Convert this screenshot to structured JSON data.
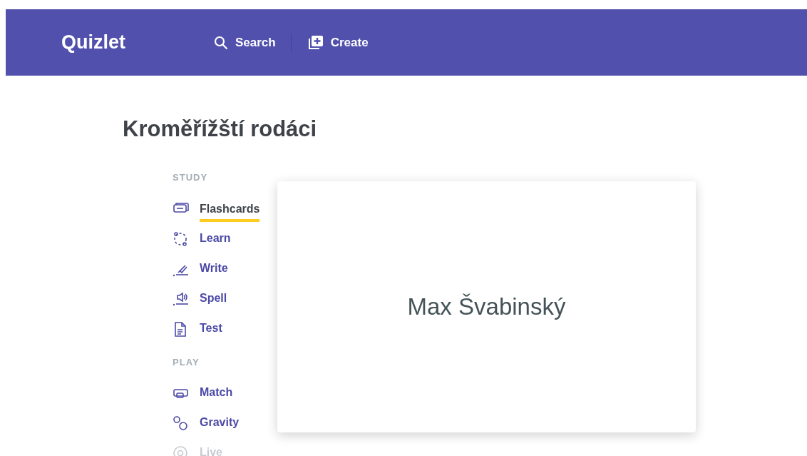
{
  "header": {
    "logo": "Quizlet",
    "nav": [
      {
        "kind": "search",
        "label": "Search"
      },
      {
        "kind": "create",
        "label": "Create"
      }
    ]
  },
  "title": "Kroměřížští rodáci",
  "sections": [
    {
      "heading": "STUDY",
      "items": [
        {
          "kind": "flashcards",
          "label": "Flashcards",
          "selected": true,
          "disabled": false
        },
        {
          "kind": "learn",
          "label": "Learn",
          "selected": false,
          "disabled": false
        },
        {
          "kind": "write",
          "label": "Write",
          "selected": false,
          "disabled": false
        },
        {
          "kind": "spell",
          "label": "Spell",
          "selected": false,
          "disabled": false
        },
        {
          "kind": "test",
          "label": "Test",
          "selected": false,
          "disabled": false
        }
      ]
    },
    {
      "heading": "PLAY",
      "items": [
        {
          "kind": "match",
          "label": "Match",
          "selected": false,
          "disabled": false
        },
        {
          "kind": "gravity",
          "label": "Gravity",
          "selected": false,
          "disabled": false
        },
        {
          "kind": "live",
          "label": "Live",
          "selected": false,
          "disabled": true
        }
      ]
    }
  ],
  "card": {
    "term": "Max Švabinský"
  }
}
